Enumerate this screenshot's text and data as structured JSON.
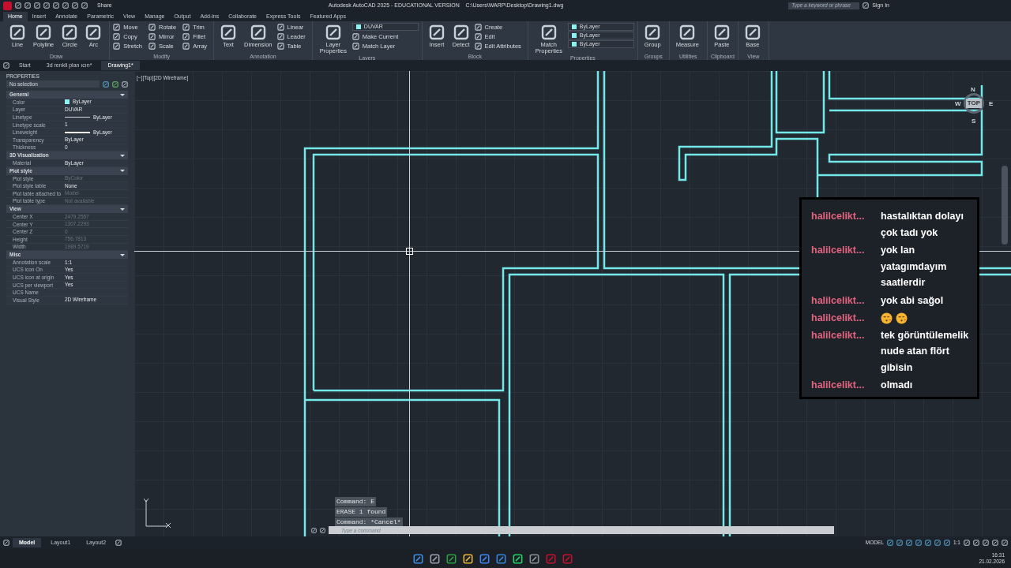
{
  "title_bar": {
    "share": "Share",
    "title": "Autodesk AutoCAD 2025 - EDUCATIONAL VERSION    C:\\Users\\WARP\\Desktop\\Drawing1.dwg",
    "search": {
      "placeholder": "Type a keyword or phrase"
    },
    "sign_in": "Sign In"
  },
  "ribbon_tabs": [
    {
      "label": "Home",
      "selected": true
    },
    {
      "label": "Insert",
      "selected": false
    },
    {
      "label": "Annotate",
      "selected": false
    },
    {
      "label": "Parametric",
      "selected": false
    },
    {
      "label": "View",
      "selected": false
    },
    {
      "label": "Manage",
      "selected": false
    },
    {
      "label": "Output",
      "selected": false
    },
    {
      "label": "Add-ins",
      "selected": false
    },
    {
      "label": "Collaborate",
      "selected": false
    },
    {
      "label": "Express Tools",
      "selected": false
    },
    {
      "label": "Featured Apps",
      "selected": false
    }
  ],
  "ribbon_panels": [
    {
      "title": "Draw",
      "tools": [
        {
          "label": "Line",
          "kind": "large"
        },
        {
          "label": "Polyline",
          "kind": "large"
        },
        {
          "label": "Circle",
          "kind": "large"
        },
        {
          "label": "Arc",
          "kind": "large"
        }
      ]
    },
    {
      "title": "Modify",
      "tools": [
        {
          "label": "Move",
          "kind": "small"
        },
        {
          "label": "Copy",
          "kind": "small"
        },
        {
          "label": "Stretch",
          "kind": "small"
        },
        {
          "label": "Rotate",
          "kind": "small"
        },
        {
          "label": "Mirror",
          "kind": "small"
        },
        {
          "label": "Scale",
          "kind": "small"
        },
        {
          "label": "Trim",
          "kind": "small"
        },
        {
          "label": "Fillet",
          "kind": "small"
        },
        {
          "label": "Array",
          "kind": "small"
        }
      ]
    },
    {
      "title": "Annotation",
      "tools": [
        {
          "label": "Text",
          "kind": "large"
        },
        {
          "label": "Dimension",
          "kind": "large"
        },
        {
          "label": "Linear",
          "kind": "small"
        },
        {
          "label": "Leader",
          "kind": "small"
        },
        {
          "label": "Table",
          "kind": "small"
        }
      ]
    },
    {
      "title": "Layers",
      "tools": [
        {
          "label": "Layer Properties",
          "kind": "large"
        },
        {
          "label": "DUVAR",
          "kind": "dropdown"
        },
        {
          "label": "Make Current",
          "kind": "small"
        },
        {
          "label": "Match Layer",
          "kind": "small"
        }
      ]
    },
    {
      "title": "Block",
      "tools": [
        {
          "label": "Insert",
          "kind": "large"
        },
        {
          "label": "Detect",
          "kind": "large"
        },
        {
          "label": "Create",
          "kind": "small"
        },
        {
          "label": "Edit",
          "kind": "small"
        },
        {
          "label": "Edit Attributes",
          "kind": "small"
        }
      ]
    },
    {
      "title": "Properties",
      "tools": [
        {
          "label": "Match Properties",
          "kind": "large"
        },
        {
          "label": "ByLayer",
          "kind": "dropdown"
        },
        {
          "label": "ByLayer",
          "kind": "dropdown"
        },
        {
          "label": "ByLayer",
          "kind": "dropdown"
        }
      ]
    },
    {
      "title": "Groups",
      "tools": [
        {
          "label": "Group",
          "kind": "large"
        }
      ]
    },
    {
      "title": "Utilities",
      "tools": [
        {
          "label": "Measure",
          "kind": "large"
        }
      ]
    },
    {
      "title": "Clipboard",
      "tools": [
        {
          "label": "Paste",
          "kind": "large"
        }
      ]
    },
    {
      "title": "View",
      "tools": [
        {
          "label": "Base",
          "kind": "large"
        }
      ]
    }
  ],
  "doc_tabs": [
    {
      "label": "Start",
      "selected": false
    },
    {
      "label": "3d renkli plan ıcın*",
      "selected": false
    },
    {
      "label": "Drawing1*",
      "selected": true
    }
  ],
  "properties": {
    "title": "PROPERTIES",
    "selection": "No selection",
    "sections": [
      {
        "title": "General",
        "expanded": true,
        "rows": [
          {
            "label": "Color",
            "value": "ByLayer",
            "kind": "swatch",
            "disabled": false
          },
          {
            "label": "Layer",
            "value": "DUVAR",
            "kind": "text",
            "disabled": false
          },
          {
            "label": "Linetype",
            "value": "ByLayer",
            "kind": "line",
            "disabled": false
          },
          {
            "label": "Linetype scale",
            "value": "1",
            "kind": "text",
            "disabled": false
          },
          {
            "label": "Lineweight",
            "value": "ByLayer",
            "kind": "thick",
            "disabled": false
          },
          {
            "label": "Transparency",
            "value": "ByLayer",
            "kind": "text",
            "disabled": false
          },
          {
            "label": "Thickness",
            "value": "0",
            "kind": "text",
            "disabled": false
          }
        ]
      },
      {
        "title": "3D Visualization",
        "expanded": true,
        "rows": [
          {
            "label": "Material",
            "value": "ByLayer",
            "kind": "text",
            "disabled": false
          }
        ]
      },
      {
        "title": "Plot style",
        "expanded": true,
        "rows": [
          {
            "label": "Plot style",
            "value": "ByColor",
            "kind": "text",
            "disabled": true
          },
          {
            "label": "Plot style table",
            "value": "None",
            "kind": "text",
            "disabled": false
          },
          {
            "label": "Plot table attached to",
            "value": "Model",
            "kind": "text",
            "disabled": true
          },
          {
            "label": "Plot table type",
            "value": "Not available",
            "kind": "text",
            "disabled": true
          }
        ]
      },
      {
        "title": "View",
        "expanded": true,
        "rows": [
          {
            "label": "Center X",
            "value": "2479.2557",
            "kind": "text",
            "disabled": true
          },
          {
            "label": "Center Y",
            "value": "1307.2293",
            "kind": "text",
            "disabled": true
          },
          {
            "label": "Center Z",
            "value": "0",
            "kind": "text",
            "disabled": true
          },
          {
            "label": "Height",
            "value": "756.7813",
            "kind": "text",
            "disabled": true
          },
          {
            "label": "Width",
            "value": "1989.5719",
            "kind": "text",
            "disabled": true
          }
        ]
      },
      {
        "title": "Misc",
        "expanded": true,
        "rows": [
          {
            "label": "Annotation scale",
            "value": "1:1",
            "kind": "text",
            "disabled": false
          },
          {
            "label": "UCS icon On",
            "value": "Yes",
            "kind": "text",
            "disabled": false
          },
          {
            "label": "UCS icon at origin",
            "value": "Yes",
            "kind": "text",
            "disabled": false
          },
          {
            "label": "UCS per viewport",
            "value": "Yes",
            "kind": "text",
            "disabled": false
          },
          {
            "label": "UCS Name",
            "kind": "text",
            "disabled": false
          },
          {
            "label": "Visual Style",
            "value": "2D Wireframe",
            "kind": "text",
            "disabled": false
          }
        ]
      }
    ]
  },
  "viewport": {
    "label": "[−][Top][2D Wireframe]",
    "viewcube": {
      "north": "N",
      "south": "S",
      "west": "W",
      "east": "E",
      "face": "TOP"
    }
  },
  "chat": [
    {
      "user": "halilcelikt...",
      "kind": "text",
      "lines": [
        "hastalıktan dolayı",
        "çok tadı yok"
      ]
    },
    {
      "user": "halilcelikt...",
      "kind": "text",
      "lines": [
        "yok lan",
        "yatagımdayım",
        "saatlerdir"
      ]
    },
    {
      "user": "halilcelikt...",
      "kind": "text",
      "lines": [
        "yok abi sağol"
      ]
    },
    {
      "user": "halilcelikt...",
      "kind": "emoji"
    },
    {
      "user": "halilcelikt...",
      "kind": "text",
      "lines": [
        "tek görüntülemelik",
        "nude atan flört",
        "gibisin"
      ]
    },
    {
      "user": "halilcelikt...",
      "kind": "text",
      "lines": [
        "olmadı"
      ]
    }
  ],
  "command_line": {
    "history": [
      "Command: E",
      "ERASE 1 found",
      "Command: *Cancel*"
    ],
    "placeholder": "Type a command"
  },
  "layout_tabs": [
    {
      "label": "Model",
      "selected": true
    },
    {
      "label": "Layout1",
      "selected": false
    },
    {
      "label": "Layout2",
      "selected": false
    }
  ],
  "status_bar": {
    "space": "MODEL",
    "scale": "1:1"
  },
  "taskbar": {
    "time": "16:31",
    "date": "21.02.2026"
  }
}
